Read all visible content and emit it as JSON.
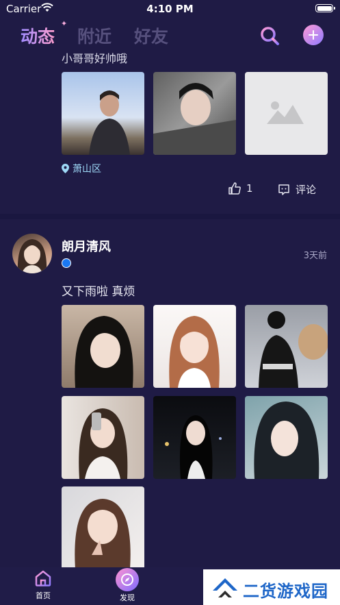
{
  "status_bar": {
    "carrier": "Carrier",
    "time": "4:10 PM"
  },
  "header": {
    "tabs": [
      {
        "label": "动态",
        "active": true
      },
      {
        "label": "附近",
        "active": false
      },
      {
        "label": "好友",
        "active": false
      }
    ]
  },
  "posts": [
    {
      "text": "小哥哥好帅哦",
      "location": "萧山区",
      "likes": "1",
      "comment_label": "评论"
    },
    {
      "username": "朗月清风",
      "time": "3天前",
      "text": "又下雨啦 真烦"
    }
  ],
  "tabbar": {
    "home_label": "首页",
    "discover_label": "发现"
  },
  "watermark": {
    "text": "二货游戏园"
  },
  "colors": {
    "background": "#1f1b45",
    "accent_pink": "#ff9fd0",
    "accent_purple": "#8f7bff"
  }
}
